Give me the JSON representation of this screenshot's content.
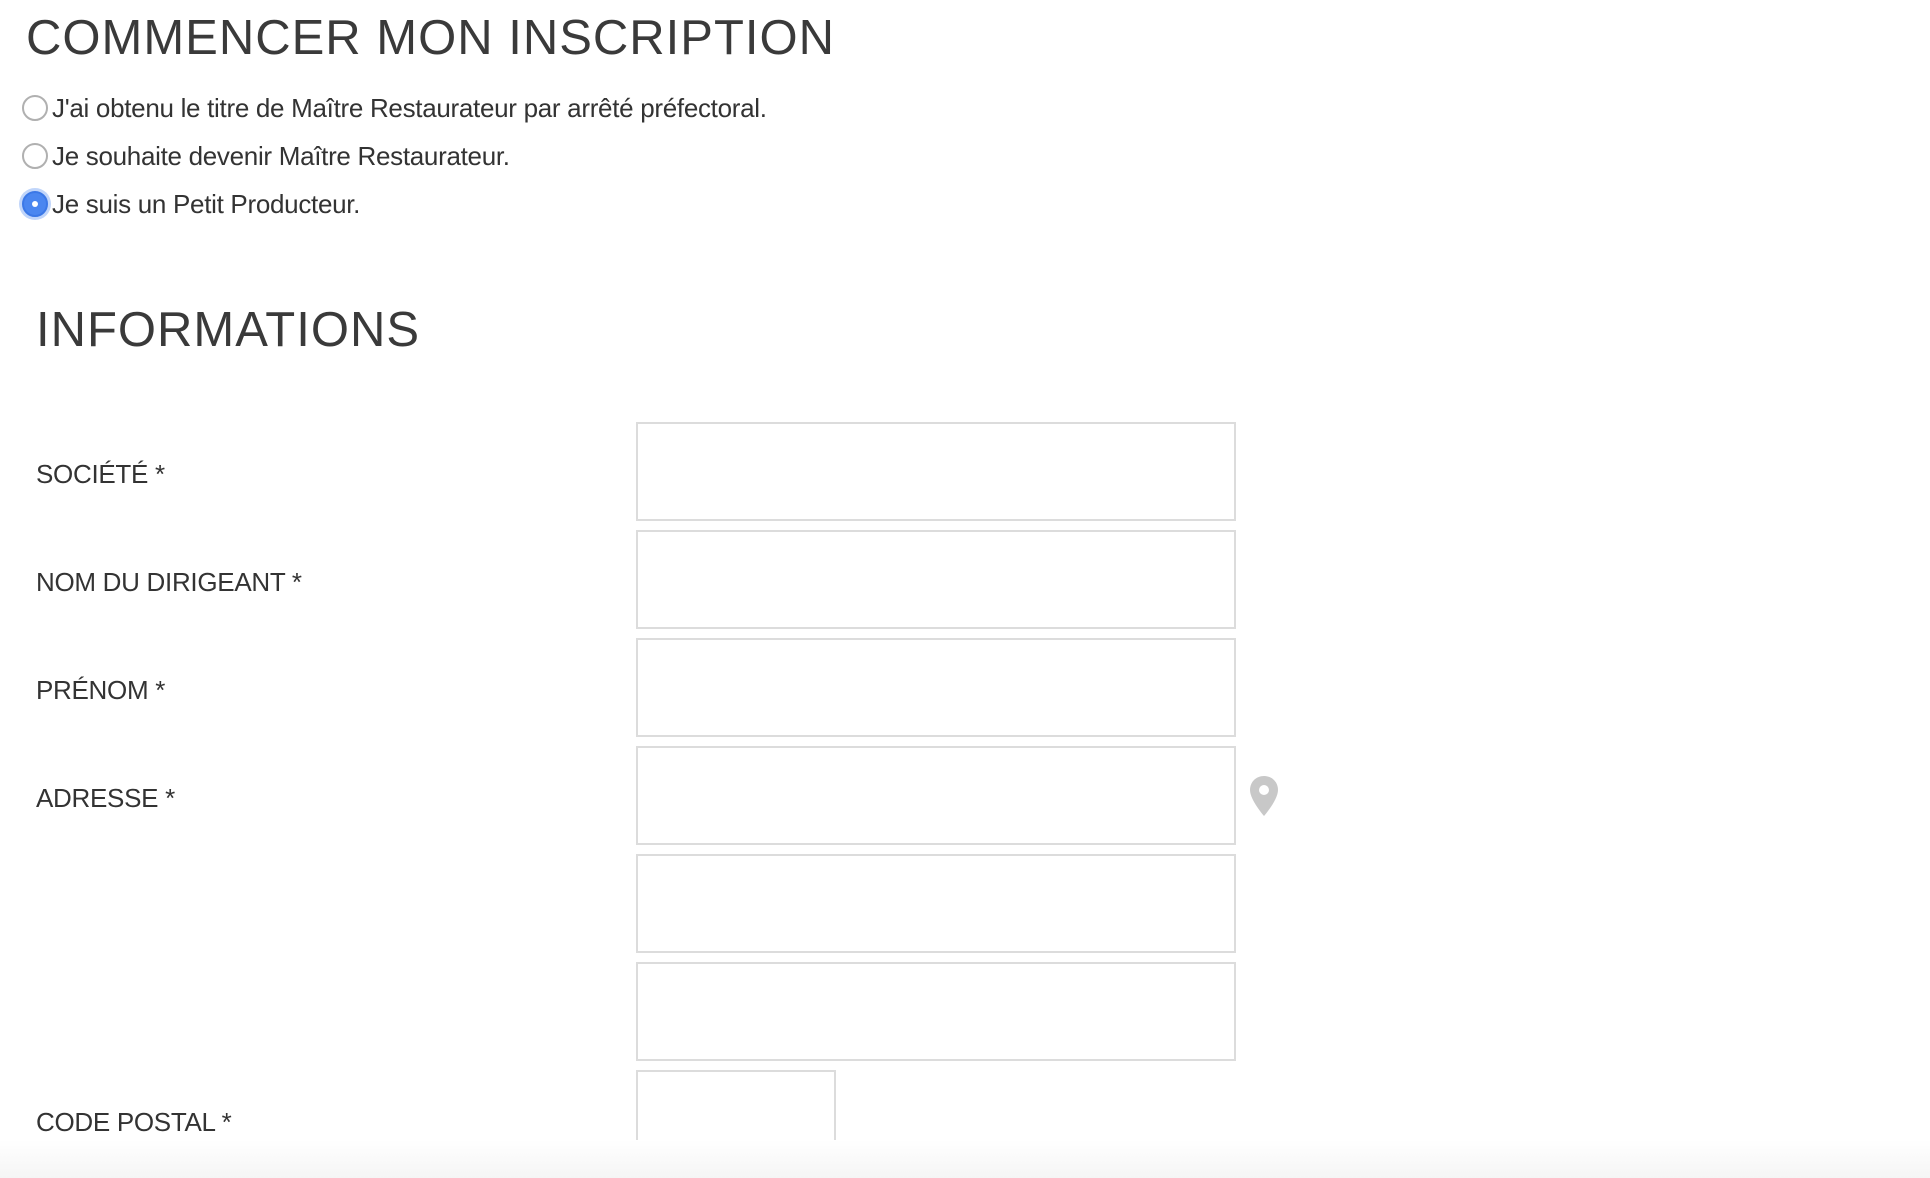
{
  "header": {
    "title": "COMMENCER MON INSCRIPTION"
  },
  "registration_type": {
    "options": [
      {
        "label": "J'ai obtenu le titre de Maître Restaurateur par arrêté préfectoral.",
        "checked": false
      },
      {
        "label": "Je souhaite devenir Maître Restaurateur.",
        "checked": false
      },
      {
        "label": "Je suis un Petit Producteur.",
        "checked": true
      }
    ]
  },
  "informations": {
    "title": "INFORMATIONS",
    "fields": {
      "societe": {
        "label": "SOCIÉTÉ *",
        "value": ""
      },
      "nom_dirigeant": {
        "label": "NOM DU DIRIGEANT *",
        "value": ""
      },
      "prenom": {
        "label": "PRÉNOM *",
        "value": ""
      },
      "adresse": {
        "label": "ADRESSE *",
        "value": "",
        "line2": "",
        "line3": "",
        "icon": "location-pin-icon"
      },
      "code_postal": {
        "label": "CODE POSTAL *",
        "value": ""
      }
    }
  },
  "colors": {
    "radio_checked": "#4a86f0",
    "input_border": "#dcdcdc",
    "pin_icon": "#c8c8c8"
  }
}
